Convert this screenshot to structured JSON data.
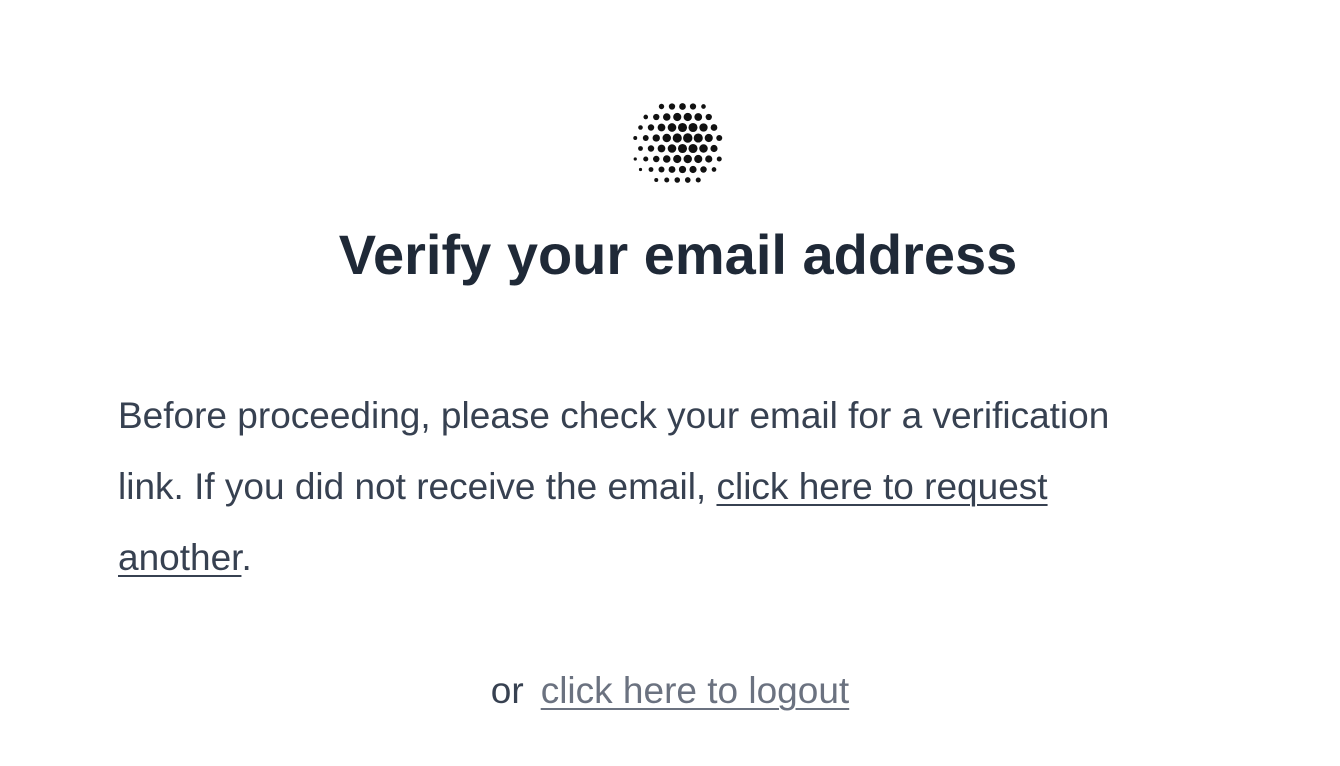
{
  "logo": {
    "icon": "dotted-sphere-icon",
    "color": "#111111"
  },
  "page": {
    "title": "Verify your email address",
    "message_text": "Before proceeding, please check your email for a verification link. If you did not receive the email, ",
    "resend_link_label": "click here to request another",
    "message_end": ".",
    "or_label": "or",
    "logout_link_label": "click here to logout"
  },
  "colors": {
    "title": "#1f2937",
    "body_text": "#374151",
    "logout_link": "#6b7280",
    "background": "#ffffff"
  }
}
